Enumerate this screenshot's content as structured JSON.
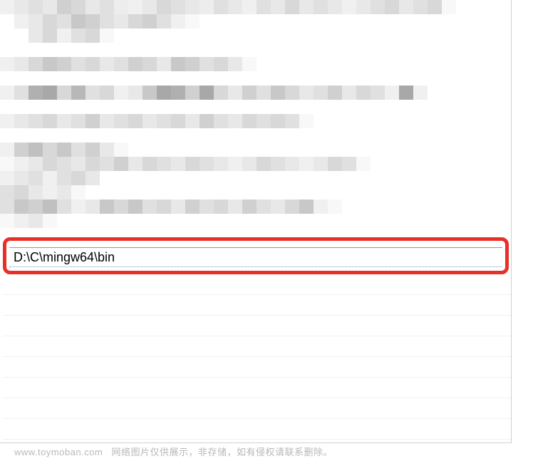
{
  "highlighted_entry": {
    "path_value": "D:\\C\\mingw64\\bin"
  },
  "watermark": {
    "domain": "www.toymoban.com",
    "notice": "网络图片仅供展示，非存储，如有侵权请联系删除。"
  },
  "pixel_mosaic": {
    "cell_size": 20,
    "rows": [
      [
        "#f0f0f0",
        "#e8e8e8",
        "#e0e0e0",
        "#e8e8e8",
        "#d0d0d0",
        "#d8d8d8",
        "#e8e8e8",
        "#e0e0e0",
        "#ededed",
        "#f0f0f0",
        "#e8e8e8",
        "#d8d8d8",
        "#e0e0e0",
        "#e8e8e8",
        "#ededed",
        "#e0e0e0",
        "#e8e8e8",
        "#f0f0f0",
        "#e0e0e0",
        "#e8e8e8",
        "#d8d8d8",
        "#e8e8e8",
        "#e0e0e0",
        "#e8e8e8",
        "#f0f0f0",
        "#e8e8e8",
        "#e0e0e0",
        "#d8d8d8",
        "#e8e8e8",
        "#e0e0e0",
        "#d8d8d8",
        "#f8f8f8",
        "#ffffff",
        "#ffffff",
        "#ffffff",
        "#ffffff"
      ],
      [
        "#ffffff",
        "#f0f0f0",
        "#e8e8e8",
        "#d8d8d8",
        "#e0e0e0",
        "#c8c8c8",
        "#d0d0d0",
        "#e0e0e0",
        "#e8e8e8",
        "#d8d8d8",
        "#d0d0d0",
        "#e0e0e0",
        "#f0f0f0",
        "#f8f8f8",
        "#ffffff",
        "#ffffff",
        "#ffffff",
        "#ffffff",
        "#ffffff",
        "#ffffff",
        "#ffffff",
        "#ffffff",
        "#ffffff",
        "#ffffff",
        "#ffffff",
        "#ffffff",
        "#ffffff",
        "#ffffff",
        "#ffffff",
        "#ffffff",
        "#ffffff",
        "#ffffff",
        "#ffffff",
        "#ffffff",
        "#ffffff",
        "#ffffff"
      ],
      [
        "#ffffff",
        "#ffffff",
        "#e8e8e8",
        "#d8d8d8",
        "#f0f0f0",
        "#e0e0e0",
        "#d8d8d8",
        "#f8f8f8",
        "#ffffff",
        "#ffffff",
        "#ffffff",
        "#ffffff",
        "#ffffff",
        "#ffffff",
        "#ffffff",
        "#ffffff",
        "#ffffff",
        "#ffffff",
        "#ffffff",
        "#ffffff",
        "#ffffff",
        "#ffffff",
        "#ffffff",
        "#ffffff",
        "#ffffff",
        "#ffffff",
        "#ffffff",
        "#ffffff",
        "#ffffff",
        "#ffffff",
        "#ffffff",
        "#ffffff",
        "#ffffff",
        "#ffffff",
        "#ffffff",
        "#ffffff"
      ],
      [
        "#ffffff",
        "#ffffff",
        "#ffffff",
        "#ffffff",
        "#ffffff",
        "#ffffff",
        "#ffffff",
        "#ffffff",
        "#ffffff",
        "#ffffff",
        "#ffffff",
        "#ffffff",
        "#ffffff",
        "#ffffff",
        "#ffffff",
        "#ffffff",
        "#ffffff",
        "#ffffff",
        "#ffffff",
        "#ffffff",
        "#ffffff",
        "#ffffff",
        "#ffffff",
        "#ffffff",
        "#ffffff",
        "#ffffff",
        "#ffffff",
        "#ffffff",
        "#ffffff",
        "#ffffff",
        "#ffffff",
        "#ffffff",
        "#ffffff",
        "#ffffff",
        "#ffffff",
        "#ffffff"
      ],
      [
        "#f0f0f0",
        "#e8e8e8",
        "#d8d8d8",
        "#c8c8c8",
        "#d0d0d0",
        "#e0e0e0",
        "#d8d8d8",
        "#e8e8e8",
        "#e0e0e0",
        "#d0d0d0",
        "#d8d8d8",
        "#e8e8e8",
        "#c8c8c8",
        "#d0d0d0",
        "#e0e0e0",
        "#d8d8d8",
        "#e8e8e8",
        "#f8f8f8",
        "#ffffff",
        "#ffffff",
        "#ffffff",
        "#ffffff",
        "#ffffff",
        "#ffffff",
        "#ffffff",
        "#ffffff",
        "#ffffff",
        "#ffffff",
        "#ffffff",
        "#ffffff",
        "#ffffff",
        "#ffffff",
        "#ffffff",
        "#ffffff",
        "#ffffff",
        "#ffffff"
      ],
      [
        "#ffffff",
        "#ffffff",
        "#ffffff",
        "#ffffff",
        "#ffffff",
        "#ffffff",
        "#ffffff",
        "#ffffff",
        "#ffffff",
        "#ffffff",
        "#ffffff",
        "#ffffff",
        "#ffffff",
        "#ffffff",
        "#ffffff",
        "#ffffff",
        "#ffffff",
        "#ffffff",
        "#ffffff",
        "#ffffff",
        "#ffffff",
        "#ffffff",
        "#ffffff",
        "#ffffff",
        "#ffffff",
        "#ffffff",
        "#ffffff",
        "#ffffff",
        "#ffffff",
        "#ffffff",
        "#ffffff",
        "#ffffff",
        "#ffffff",
        "#ffffff",
        "#ffffff",
        "#ffffff"
      ],
      [
        "#f0f0f0",
        "#e0e0e0",
        "#b0b0b0",
        "#a8a8a8",
        "#d8d8d8",
        "#b8b8b8",
        "#e0e0e0",
        "#d8d8d8",
        "#f0f0f0",
        "#e8e8e8",
        "#c8c8c8",
        "#a8a8a8",
        "#b0b0b0",
        "#d0d0d0",
        "#a8a8a8",
        "#d8d8d8",
        "#e8e8e8",
        "#d0d0d0",
        "#e0e0e0",
        "#c8c8c8",
        "#d8d8d8",
        "#e8e8e8",
        "#e0e0e0",
        "#d0d0d0",
        "#e8e8e8",
        "#d8d8d8",
        "#e0e0e0",
        "#f0f0f0",
        "#a8a8a8",
        "#f0f0f0",
        "#ffffff",
        "#ffffff",
        "#ffffff",
        "#ffffff",
        "#ffffff",
        "#ffffff"
      ],
      [
        "#ffffff",
        "#ffffff",
        "#ffffff",
        "#ffffff",
        "#ffffff",
        "#ffffff",
        "#ffffff",
        "#ffffff",
        "#ffffff",
        "#ffffff",
        "#ffffff",
        "#ffffff",
        "#ffffff",
        "#ffffff",
        "#ffffff",
        "#ffffff",
        "#ffffff",
        "#ffffff",
        "#ffffff",
        "#ffffff",
        "#ffffff",
        "#ffffff",
        "#ffffff",
        "#ffffff",
        "#ffffff",
        "#ffffff",
        "#ffffff",
        "#ffffff",
        "#ffffff",
        "#ffffff",
        "#ffffff",
        "#ffffff",
        "#ffffff",
        "#ffffff",
        "#ffffff",
        "#ffffff"
      ],
      [
        "#f0f0f0",
        "#e8e8e8",
        "#e0e0e0",
        "#d8d8d8",
        "#e8e8e8",
        "#e0e0e0",
        "#d0d0d0",
        "#e8e8e8",
        "#e0e0e0",
        "#d8d8d8",
        "#e8e8e8",
        "#e0e0e0",
        "#d8d8d8",
        "#e8e8e8",
        "#d0d0d0",
        "#e0e0e0",
        "#e8e8e8",
        "#d8d8d8",
        "#e0e0e0",
        "#d8d8d8",
        "#e0e0e0",
        "#f8f8f8",
        "#ffffff",
        "#ffffff",
        "#ffffff",
        "#ffffff",
        "#ffffff",
        "#ffffff",
        "#ffffff",
        "#ffffff",
        "#ffffff",
        "#ffffff",
        "#ffffff",
        "#ffffff",
        "#ffffff",
        "#ffffff"
      ],
      [
        "#ffffff",
        "#ffffff",
        "#ffffff",
        "#ffffff",
        "#ffffff",
        "#ffffff",
        "#ffffff",
        "#ffffff",
        "#ffffff",
        "#ffffff",
        "#ffffff",
        "#ffffff",
        "#ffffff",
        "#ffffff",
        "#ffffff",
        "#ffffff",
        "#ffffff",
        "#ffffff",
        "#ffffff",
        "#ffffff",
        "#ffffff",
        "#ffffff",
        "#ffffff",
        "#ffffff",
        "#ffffff",
        "#ffffff",
        "#ffffff",
        "#ffffff",
        "#ffffff",
        "#ffffff",
        "#ffffff",
        "#ffffff",
        "#ffffff",
        "#ffffff",
        "#ffffff",
        "#ffffff"
      ],
      [
        "#f0f0f0",
        "#d0d0d0",
        "#c0c0c0",
        "#d8d8d8",
        "#c8c8c8",
        "#e0e0e0",
        "#d0d0d0",
        "#e8e8e8",
        "#f8f8f8",
        "#ffffff",
        "#ffffff",
        "#ffffff",
        "#ffffff",
        "#ffffff",
        "#ffffff",
        "#ffffff",
        "#ffffff",
        "#ffffff",
        "#ffffff",
        "#ffffff",
        "#ffffff",
        "#ffffff",
        "#ffffff",
        "#ffffff",
        "#ffffff",
        "#ffffff",
        "#ffffff",
        "#ffffff",
        "#ffffff",
        "#ffffff",
        "#ffffff",
        "#ffffff",
        "#ffffff",
        "#ffffff",
        "#ffffff",
        "#ffffff"
      ],
      [
        "#f8f8f8",
        "#f0f0f0",
        "#e8e8e8",
        "#d8d8d8",
        "#e0e0e0",
        "#e8e8e8",
        "#d8d8d8",
        "#e0e0e0",
        "#d0d0d0",
        "#e8e8e8",
        "#d8d8d8",
        "#e0e0e0",
        "#e8e8e8",
        "#d8d8d8",
        "#e0e0e0",
        "#e8e8e8",
        "#f0f0f0",
        "#e8e8e8",
        "#d8d8d8",
        "#e0e0e0",
        "#e8e8e8",
        "#f0f0f0",
        "#e8e8e8",
        "#d8d8d8",
        "#e0e0e0",
        "#f8f8f8",
        "#ffffff",
        "#ffffff",
        "#ffffff",
        "#ffffff",
        "#ffffff",
        "#ffffff",
        "#ffffff",
        "#ffffff",
        "#ffffff",
        "#ffffff"
      ],
      [
        "#f0f0f0",
        "#e8e8e8",
        "#e0e0e0",
        "#f0f0f0",
        "#e0e0e0",
        "#d8d8d8",
        "#e8e8e8",
        "#ffffff",
        "#ffffff",
        "#ffffff",
        "#ffffff",
        "#ffffff",
        "#ffffff",
        "#ffffff",
        "#ffffff",
        "#ffffff",
        "#ffffff",
        "#ffffff",
        "#ffffff",
        "#ffffff",
        "#ffffff",
        "#ffffff",
        "#ffffff",
        "#ffffff",
        "#ffffff",
        "#ffffff",
        "#ffffff",
        "#ffffff",
        "#ffffff",
        "#ffffff",
        "#ffffff",
        "#ffffff",
        "#ffffff",
        "#ffffff",
        "#ffffff",
        "#ffffff"
      ],
      [
        "#e0e0e0",
        "#d8d8d8",
        "#e8e8e8",
        "#f0f0f0",
        "#e8e8e8",
        "#f8f8f8",
        "#ffffff",
        "#ffffff",
        "#ffffff",
        "#ffffff",
        "#ffffff",
        "#ffffff",
        "#ffffff",
        "#ffffff",
        "#ffffff",
        "#ffffff",
        "#ffffff",
        "#ffffff",
        "#ffffff",
        "#ffffff",
        "#ffffff",
        "#ffffff",
        "#ffffff",
        "#ffffff",
        "#ffffff",
        "#ffffff",
        "#ffffff",
        "#ffffff",
        "#ffffff",
        "#ffffff",
        "#ffffff",
        "#ffffff",
        "#ffffff",
        "#ffffff",
        "#ffffff",
        "#ffffff"
      ],
      [
        "#e0e0e0",
        "#c8c8c8",
        "#d0d0d0",
        "#c0c0c0",
        "#e0e0e0",
        "#f0f0f0",
        "#e8e8e8",
        "#c8c8c8",
        "#d8d8d8",
        "#c8c8c8",
        "#e0e0e0",
        "#d8d8d8",
        "#e8e8e8",
        "#d0d0d0",
        "#e0e0e0",
        "#d8d8d8",
        "#e8e8e8",
        "#d0d0d0",
        "#e0e0e0",
        "#e8e8e8",
        "#d8d8d8",
        "#c8c8c8",
        "#f0f0f0",
        "#f8f8f8",
        "#ffffff",
        "#ffffff",
        "#ffffff",
        "#ffffff",
        "#ffffff",
        "#ffffff",
        "#ffffff",
        "#ffffff",
        "#ffffff",
        "#ffffff",
        "#ffffff",
        "#ffffff"
      ],
      [
        "#f8f8f8",
        "#f0f0f0",
        "#e8e8e8",
        "#f8f8f8",
        "#ffffff",
        "#ffffff",
        "#ffffff",
        "#ffffff",
        "#ffffff",
        "#ffffff",
        "#ffffff",
        "#ffffff",
        "#ffffff",
        "#ffffff",
        "#ffffff",
        "#ffffff",
        "#ffffff",
        "#ffffff",
        "#ffffff",
        "#ffffff",
        "#ffffff",
        "#ffffff",
        "#ffffff",
        "#ffffff",
        "#ffffff",
        "#ffffff",
        "#ffffff",
        "#ffffff",
        "#ffffff",
        "#ffffff",
        "#ffffff",
        "#ffffff",
        "#ffffff",
        "#ffffff",
        "#ffffff",
        "#ffffff"
      ],
      [
        "#ffffff",
        "#ffffff",
        "#ffffff",
        "#ffffff",
        "#ffffff",
        "#ffffff",
        "#ffffff",
        "#ffffff",
        "#ffffff",
        "#ffffff",
        "#ffffff",
        "#ffffff",
        "#ffffff",
        "#ffffff",
        "#ffffff",
        "#ffffff",
        "#ffffff",
        "#ffffff",
        "#ffffff",
        "#ffffff",
        "#ffffff",
        "#ffffff",
        "#ffffff",
        "#ffffff",
        "#ffffff",
        "#ffffff",
        "#ffffff",
        "#ffffff",
        "#ffffff",
        "#ffffff",
        "#ffffff",
        "#ffffff",
        "#ffffff",
        "#ffffff",
        "#ffffff",
        "#ffffff"
      ]
    ]
  }
}
